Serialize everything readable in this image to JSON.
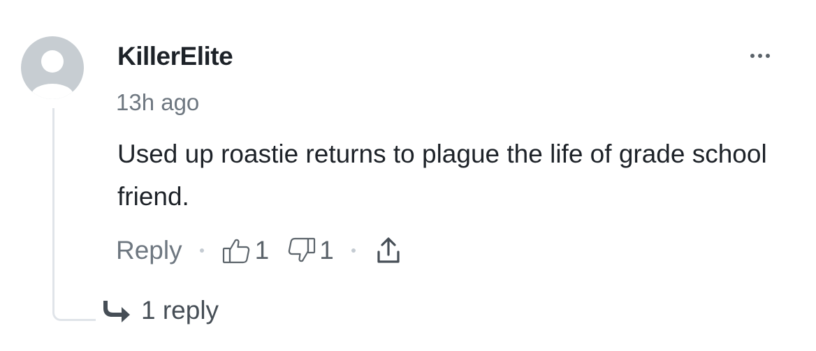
{
  "comment": {
    "author": "KillerElite",
    "timestamp": "13h ago",
    "text": "Used up roastie returns to plague the life of grade school friend.",
    "avatar_icon": "user-silhouette-icon",
    "more_icon": "more-horizontal-icon"
  },
  "actions": {
    "reply_label": "Reply",
    "upvote_count": "1",
    "downvote_count": "1",
    "upvote_icon": "thumbs-up-icon",
    "downvote_icon": "thumbs-down-icon",
    "share_icon": "share-icon"
  },
  "replies": {
    "label": "1 reply",
    "icon": "reply-arrow-icon"
  },
  "colors": {
    "text_primary": "#1d2228",
    "text_secondary": "#6e7780",
    "avatar": "#c7cdd2",
    "thread_line": "#e0e4e9"
  }
}
